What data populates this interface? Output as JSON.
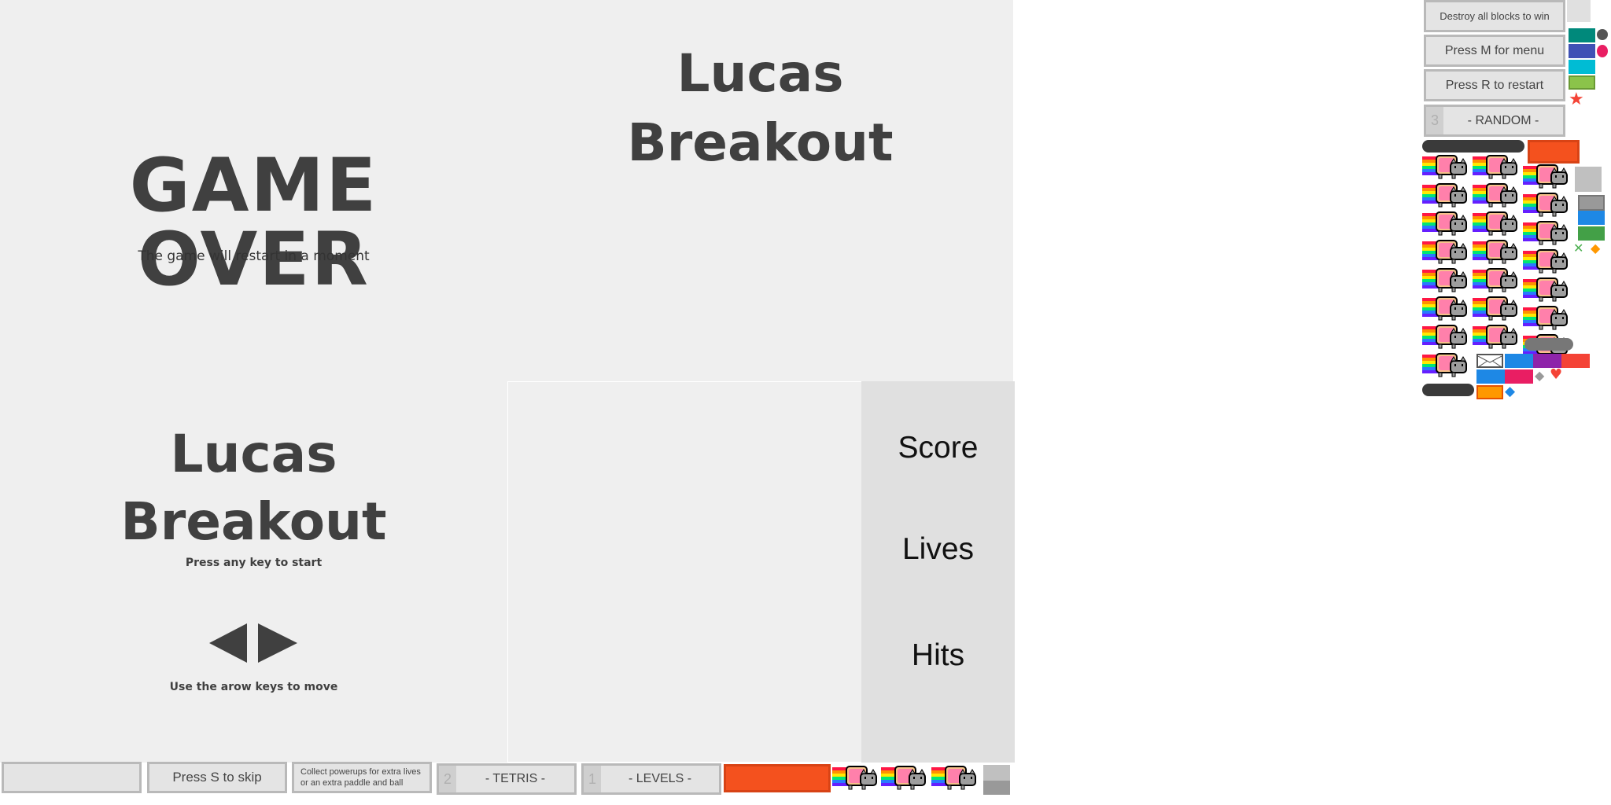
{
  "gameover": {
    "title": "GAME OVER",
    "subtitle": "The game will restart in a moment"
  },
  "title_top": {
    "line1": "Lucas",
    "line2": "Breakout"
  },
  "start": {
    "line1": "Lucas",
    "line2": "Breakout",
    "press": "Press any key to start",
    "move": "Use the arow keys to move"
  },
  "sidebar": {
    "score": "Score",
    "lives": "Lives",
    "hits": "Hits"
  },
  "buttons": {
    "destroy": "Destroy all blocks to win",
    "menu": "Press M for menu",
    "restart": "Press R to restart",
    "random_num": "3",
    "random": "- RANDOM -",
    "blank": "",
    "skip": "Press S to skip",
    "powerups": "Collect powerups for extra lives or an extra paddle and ball",
    "tetris_num": "2",
    "tetris": "- TETRIS -",
    "levels_num": "1",
    "levels": "- LEVELS -"
  },
  "colors": {
    "panel": "#efefef",
    "sidebar": "#e0e0e0",
    "text": "#404040",
    "brick_orange": "#f4511e"
  }
}
